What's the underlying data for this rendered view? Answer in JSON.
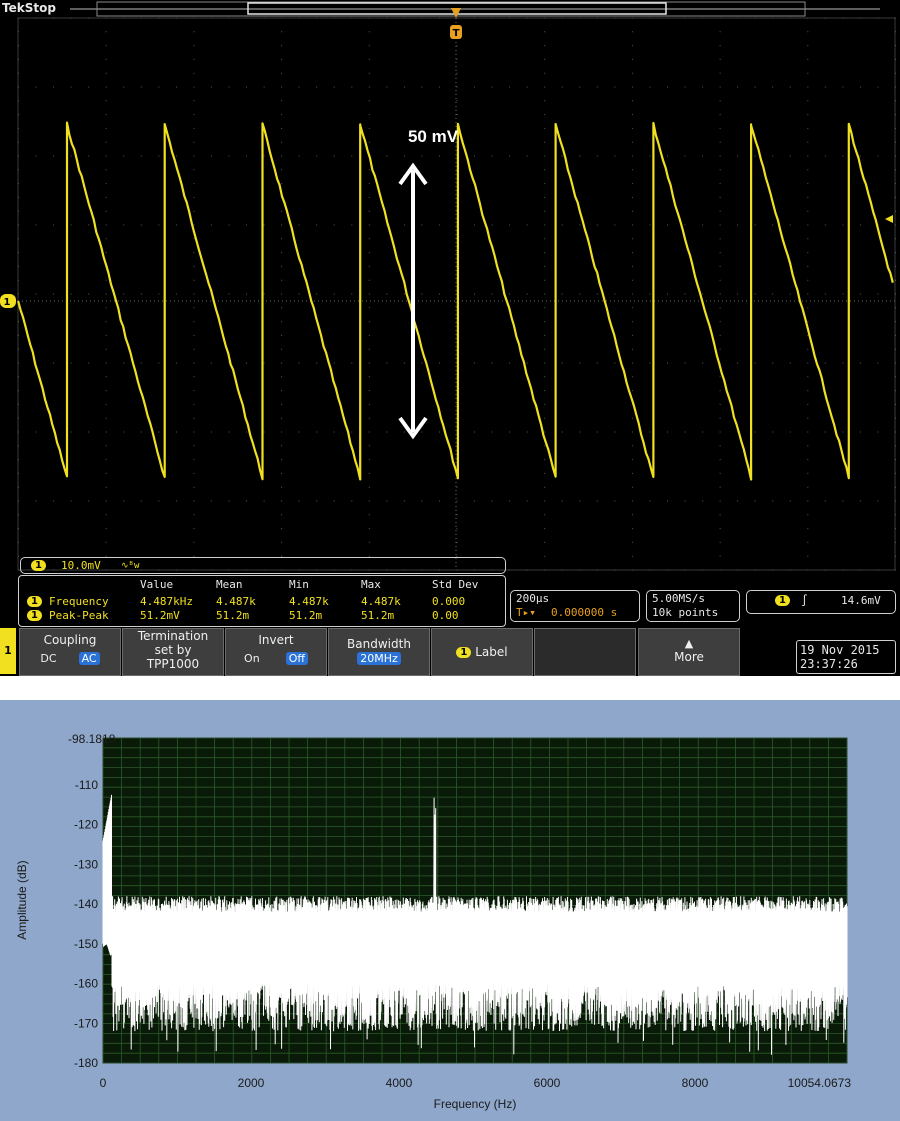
{
  "oscilloscope": {
    "brand": "Tek",
    "status": "Stop",
    "trigger_marker": "T",
    "annotation": "50 mV",
    "ch1": {
      "badge": "1",
      "scale": "10.0mV",
      "bw_symbol": "∿ᴮw",
      "color": "#f0e020"
    },
    "measure_table": {
      "headers": [
        "Value",
        "Mean",
        "Min",
        "Max",
        "Std Dev"
      ],
      "rows": [
        {
          "name": "Frequency",
          "cells": [
            "4.487kHz",
            "4.487k",
            "4.487k",
            "4.487k",
            "0.000"
          ]
        },
        {
          "name": "Peak-Peak",
          "cells": [
            "51.2mV",
            "51.2m",
            "51.2m",
            "51.2m",
            "0.00"
          ]
        }
      ]
    },
    "timebase": {
      "per_div": "200µs",
      "trigger_pos": "0.000000 s"
    },
    "sample": {
      "rate": "5.00MS/s",
      "points": "10k points"
    },
    "trigger": {
      "level": "14.6mV"
    },
    "datetime": {
      "date": "19 Nov 2015",
      "time": "23:37:26"
    },
    "menu_channel": "1",
    "softkeys": {
      "coupling": {
        "title": "Coupling",
        "opt1": "DC",
        "opt2": "AC"
      },
      "termination": {
        "line1": "Termination",
        "line2": "set by",
        "line3": "TPP1000"
      },
      "invert": {
        "title": "Invert",
        "opt1": "On",
        "opt2": "Off"
      },
      "bandwidth": {
        "title": "Bandwidth",
        "value": "20MHz"
      },
      "label": {
        "badge": "1",
        "text": "Label"
      },
      "more": {
        "text": "More"
      }
    },
    "waveform": {
      "frequency_khz": 4.487,
      "peak_to_peak_mv": 51.2,
      "volts_per_div_mv": 10.0,
      "time_per_div_us": 200,
      "shape": "sawtooth"
    }
  },
  "spectrum": {
    "top_label": "-98.1818",
    "y_ticks": [
      "-110",
      "-120",
      "-130",
      "-140",
      "-150",
      "-160",
      "-170",
      "-180"
    ],
    "x_ticks": [
      "0",
      "2000",
      "4000",
      "6000",
      "8000",
      "10054.0673"
    ],
    "xlabel": "Frequency (Hz)",
    "ylabel": "Amplitude (dB)",
    "chart_data": {
      "type": "line",
      "xlim": [
        0,
        10054.0673
      ],
      "ylim": [
        -180,
        -98.1818
      ],
      "xlabel": "Frequency (Hz)",
      "ylabel": "Amplitude (dB)",
      "peak": {
        "x": 4487,
        "y": -121
      },
      "noise_floor": {
        "upper_db": -140,
        "lower_db": -160
      },
      "grid": true,
      "background": "#0a1a08",
      "trace_color": "#ffffff"
    }
  }
}
